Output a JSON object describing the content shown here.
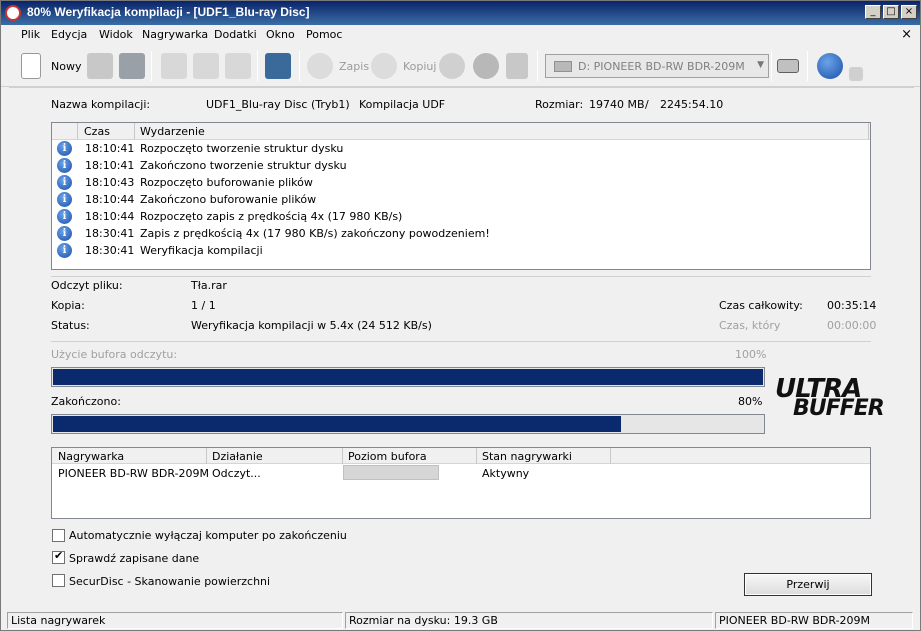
{
  "window": {
    "title": "80% Weryfikacja kompilacji - [UDF1_Blu-ray Disc]",
    "min": "_",
    "max": "□",
    "close": "×"
  },
  "menu": [
    "Plik",
    "Edycja",
    "Widok",
    "Nagrywarka",
    "Dodatki",
    "Okno",
    "Pomoc"
  ],
  "menu_close": "×",
  "toolbar": {
    "new_label": "Nowy",
    "burn_label": "Zapis",
    "copy_label": "Kopiuj",
    "drive": "D: PIONEER BD-RW   BDR-209M"
  },
  "info": {
    "name_label": "Nazwa kompilacji:",
    "name_value": "UDF1_Blu-ray Disc (Tryb1)",
    "type_value": "Kompilacja UDF",
    "size_label": "Rozmiar:",
    "size_value": "19740 MB",
    "size_sep": "/",
    "size_time": "2245:54.10"
  },
  "log": {
    "col_time": "Czas",
    "col_event": "Wydarzenie",
    "rows": [
      {
        "time": "18:10:41",
        "event": "Rozpoczęto tworzenie struktur dysku"
      },
      {
        "time": "18:10:41",
        "event": "Zakończono tworzenie struktur dysku"
      },
      {
        "time": "18:10:43",
        "event": "Rozpoczęto buforowanie plików"
      },
      {
        "time": "18:10:44",
        "event": "Zakończono buforowanie plików"
      },
      {
        "time": "18:10:44",
        "event": "Rozpoczęto zapis z prędkością 4x (17 980 KB/s)"
      },
      {
        "time": "18:30:41",
        "event": "Zapis z prędkością 4x (17 980 KB/s) zakończony powodzeniem!"
      },
      {
        "time": "18:30:41",
        "event": "Weryfikacja kompilacji"
      }
    ]
  },
  "status": {
    "read_label": "Odczyt pliku:",
    "read_value": "Tła.rar",
    "copy_label": "Kopia:",
    "copy_value": "1 / 1",
    "status_label": "Status:",
    "status_value": "Weryfikacja kompilacji w 5.4x (24 512 KB/s)",
    "total_label": "Czas całkowity:",
    "total_value": "00:35:14",
    "remain_label": "Czas, który",
    "remain_value": "00:00:00"
  },
  "progress": {
    "buffer_label": "Użycie bufora odczytu:",
    "buffer_pct_text": "100%",
    "buffer_fraction": 1.0,
    "done_label": "Zakończono:",
    "done_pct_text": "80%",
    "done_fraction": 0.8
  },
  "logo": {
    "line1": "ULTRA",
    "line2": "BUFFER"
  },
  "recorders": {
    "cols": [
      "Nagrywarka",
      "Działanie",
      "Poziom bufora",
      "Stan nagrywarki"
    ],
    "row": {
      "name": "PIONEER BD-RW   BDR-209M",
      "action": "Odczyt...",
      "state": "Aktywny"
    }
  },
  "options": [
    {
      "label": "Automatycznie wyłączaj komputer po zakończeniu",
      "checked": false
    },
    {
      "label": "Sprawdź zapisane dane",
      "checked": true
    },
    {
      "label": "SecurDisc - Skanowanie powierzchni",
      "checked": false
    }
  ],
  "check_mark": "✔",
  "stop_button": "Przerwij",
  "statusbar": {
    "left": "Lista nagrywarek",
    "middle": "Rozmiar na dysku: 19.3 GB",
    "right": "PIONEER  BD-RW   BDR-209M"
  }
}
